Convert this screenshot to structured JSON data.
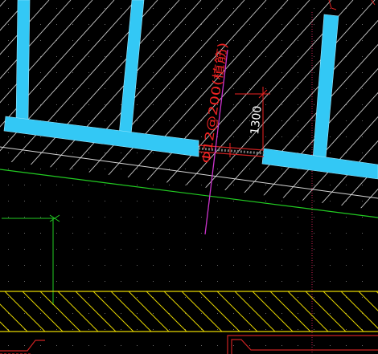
{
  "drawing": {
    "rebar_annotation": "Φ12@200(植筋)",
    "dimension_value": "1300"
  },
  "colors": {
    "background": "#000000",
    "wall": "#33c8f5",
    "hatch": "#c8c8c8",
    "rebar": "#cc2222",
    "annotation": "#ee2222",
    "dimension_text": "#ffffff",
    "section_line": "#cc33cc",
    "grid_line": "#cc2255",
    "axis_line": "#22cc22",
    "foundation_hatch": "#e6d600",
    "outline": "#cc2222",
    "dot_grid": "#6a6a6a"
  }
}
